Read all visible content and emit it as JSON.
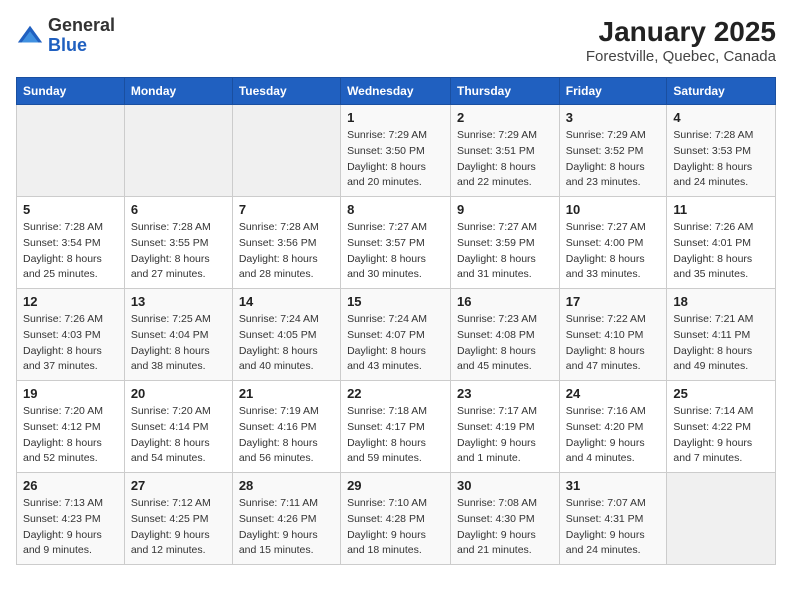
{
  "header": {
    "logo_general": "General",
    "logo_blue": "Blue",
    "title": "January 2025",
    "subtitle": "Forestville, Quebec, Canada"
  },
  "calendar": {
    "days_of_week": [
      "Sunday",
      "Monday",
      "Tuesday",
      "Wednesday",
      "Thursday",
      "Friday",
      "Saturday"
    ],
    "weeks": [
      [
        {
          "day": "",
          "info": ""
        },
        {
          "day": "",
          "info": ""
        },
        {
          "day": "",
          "info": ""
        },
        {
          "day": "1",
          "info": "Sunrise: 7:29 AM\nSunset: 3:50 PM\nDaylight: 8 hours\nand 20 minutes."
        },
        {
          "day": "2",
          "info": "Sunrise: 7:29 AM\nSunset: 3:51 PM\nDaylight: 8 hours\nand 22 minutes."
        },
        {
          "day": "3",
          "info": "Sunrise: 7:29 AM\nSunset: 3:52 PM\nDaylight: 8 hours\nand 23 minutes."
        },
        {
          "day": "4",
          "info": "Sunrise: 7:28 AM\nSunset: 3:53 PM\nDaylight: 8 hours\nand 24 minutes."
        }
      ],
      [
        {
          "day": "5",
          "info": "Sunrise: 7:28 AM\nSunset: 3:54 PM\nDaylight: 8 hours\nand 25 minutes."
        },
        {
          "day": "6",
          "info": "Sunrise: 7:28 AM\nSunset: 3:55 PM\nDaylight: 8 hours\nand 27 minutes."
        },
        {
          "day": "7",
          "info": "Sunrise: 7:28 AM\nSunset: 3:56 PM\nDaylight: 8 hours\nand 28 minutes."
        },
        {
          "day": "8",
          "info": "Sunrise: 7:27 AM\nSunset: 3:57 PM\nDaylight: 8 hours\nand 30 minutes."
        },
        {
          "day": "9",
          "info": "Sunrise: 7:27 AM\nSunset: 3:59 PM\nDaylight: 8 hours\nand 31 minutes."
        },
        {
          "day": "10",
          "info": "Sunrise: 7:27 AM\nSunset: 4:00 PM\nDaylight: 8 hours\nand 33 minutes."
        },
        {
          "day": "11",
          "info": "Sunrise: 7:26 AM\nSunset: 4:01 PM\nDaylight: 8 hours\nand 35 minutes."
        }
      ],
      [
        {
          "day": "12",
          "info": "Sunrise: 7:26 AM\nSunset: 4:03 PM\nDaylight: 8 hours\nand 37 minutes."
        },
        {
          "day": "13",
          "info": "Sunrise: 7:25 AM\nSunset: 4:04 PM\nDaylight: 8 hours\nand 38 minutes."
        },
        {
          "day": "14",
          "info": "Sunrise: 7:24 AM\nSunset: 4:05 PM\nDaylight: 8 hours\nand 40 minutes."
        },
        {
          "day": "15",
          "info": "Sunrise: 7:24 AM\nSunset: 4:07 PM\nDaylight: 8 hours\nand 43 minutes."
        },
        {
          "day": "16",
          "info": "Sunrise: 7:23 AM\nSunset: 4:08 PM\nDaylight: 8 hours\nand 45 minutes."
        },
        {
          "day": "17",
          "info": "Sunrise: 7:22 AM\nSunset: 4:10 PM\nDaylight: 8 hours\nand 47 minutes."
        },
        {
          "day": "18",
          "info": "Sunrise: 7:21 AM\nSunset: 4:11 PM\nDaylight: 8 hours\nand 49 minutes."
        }
      ],
      [
        {
          "day": "19",
          "info": "Sunrise: 7:20 AM\nSunset: 4:12 PM\nDaylight: 8 hours\nand 52 minutes."
        },
        {
          "day": "20",
          "info": "Sunrise: 7:20 AM\nSunset: 4:14 PM\nDaylight: 8 hours\nand 54 minutes."
        },
        {
          "day": "21",
          "info": "Sunrise: 7:19 AM\nSunset: 4:16 PM\nDaylight: 8 hours\nand 56 minutes."
        },
        {
          "day": "22",
          "info": "Sunrise: 7:18 AM\nSunset: 4:17 PM\nDaylight: 8 hours\nand 59 minutes."
        },
        {
          "day": "23",
          "info": "Sunrise: 7:17 AM\nSunset: 4:19 PM\nDaylight: 9 hours\nand 1 minute."
        },
        {
          "day": "24",
          "info": "Sunrise: 7:16 AM\nSunset: 4:20 PM\nDaylight: 9 hours\nand 4 minutes."
        },
        {
          "day": "25",
          "info": "Sunrise: 7:14 AM\nSunset: 4:22 PM\nDaylight: 9 hours\nand 7 minutes."
        }
      ],
      [
        {
          "day": "26",
          "info": "Sunrise: 7:13 AM\nSunset: 4:23 PM\nDaylight: 9 hours\nand 9 minutes."
        },
        {
          "day": "27",
          "info": "Sunrise: 7:12 AM\nSunset: 4:25 PM\nDaylight: 9 hours\nand 12 minutes."
        },
        {
          "day": "28",
          "info": "Sunrise: 7:11 AM\nSunset: 4:26 PM\nDaylight: 9 hours\nand 15 minutes."
        },
        {
          "day": "29",
          "info": "Sunrise: 7:10 AM\nSunset: 4:28 PM\nDaylight: 9 hours\nand 18 minutes."
        },
        {
          "day": "30",
          "info": "Sunrise: 7:08 AM\nSunset: 4:30 PM\nDaylight: 9 hours\nand 21 minutes."
        },
        {
          "day": "31",
          "info": "Sunrise: 7:07 AM\nSunset: 4:31 PM\nDaylight: 9 hours\nand 24 minutes."
        },
        {
          "day": "",
          "info": ""
        }
      ]
    ]
  }
}
